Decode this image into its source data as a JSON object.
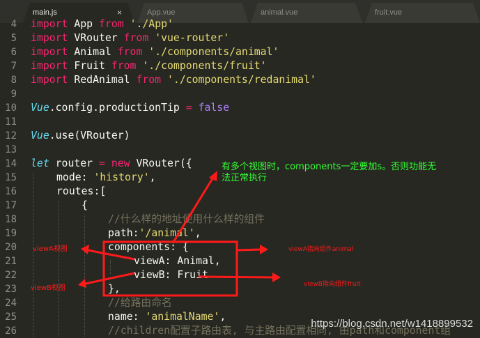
{
  "tabs": [
    {
      "label": "main.js",
      "active": true
    },
    {
      "label": "App.vue",
      "active": false
    },
    {
      "label": "animal.vue",
      "active": false
    },
    {
      "label": "fruit.vue",
      "active": false
    }
  ],
  "tab_close_glyph": "×",
  "line_numbers": [
    "4",
    "5",
    "6",
    "7",
    "8",
    "9",
    "10",
    "11",
    "12",
    "13",
    "14",
    "15",
    "16",
    "17",
    "18",
    "19",
    "20",
    "21",
    "22",
    "23",
    "24",
    "25",
    "26"
  ],
  "code": {
    "l4": {
      "kw": "import",
      "name": " App ",
      "from": "from",
      "str": "'./App'"
    },
    "l5": {
      "kw": "import",
      "name": " VRouter ",
      "from": "from",
      "str": "'vue-router'"
    },
    "l6": {
      "kw": "import",
      "name": " Animal ",
      "from": "from",
      "str": "'./components/animal'"
    },
    "l7": {
      "kw": "import",
      "name": " Fruit ",
      "from": "from",
      "str": "'./components/fruit'"
    },
    "l8": {
      "kw": "import",
      "name": " RedAnimal ",
      "from": "from",
      "str": "'./components/redanimal'"
    },
    "l10": {
      "obj": "Vue",
      "rest": ".config.productionTip ",
      "op": "=",
      "val": " false"
    },
    "l12": {
      "obj": "Vue",
      "rest": ".use(VRouter)"
    },
    "l14": {
      "kw": "let",
      "mid": " router ",
      "op": "=",
      "new": " new",
      "rest": " VRouter({"
    },
    "l15": {
      "key": "mode: ",
      "str": "'history'",
      "end": ","
    },
    "l16": {
      "text": "routes:["
    },
    "l17": {
      "text": "{"
    },
    "l18": {
      "comment": "//什么样的地址使用什么样的组件"
    },
    "l19": {
      "key": "path:",
      "str": "'/animal'",
      "end": ","
    },
    "l20": {
      "text": "components: {"
    },
    "l21": {
      "text": "viewA: Animal,"
    },
    "l22": {
      "text": "viewB: Fruit"
    },
    "l23": {
      "text": "},"
    },
    "l24": {
      "comment": "//给路由命名"
    },
    "l25": {
      "key": "name: ",
      "str": "'animalName'",
      "end": ","
    },
    "l26": {
      "comment": "//children配置子路由表, 与主路由配置相同, 由path和component组"
    }
  },
  "annotations": {
    "main_note_line1": "有多个视图时，components一定要加s。否则功能无",
    "main_note_line2": "法正常执行",
    "viewA_left": "viewA视图",
    "viewB_left": "viewB视图",
    "viewA_right": "viewA指向组件animal",
    "viewB_right": "viewB指向组件fruit"
  },
  "watermark": "https://blog.csdn.net/w1418899532",
  "colors": {
    "background": "#272822",
    "keyword": "#f92672",
    "string": "#e6db74",
    "italic_type": "#66d9ef",
    "boolean": "#ae81ff",
    "comment": "#75715e",
    "annotation_red": "#ff1a1a",
    "annotation_green": "#33ff33"
  }
}
